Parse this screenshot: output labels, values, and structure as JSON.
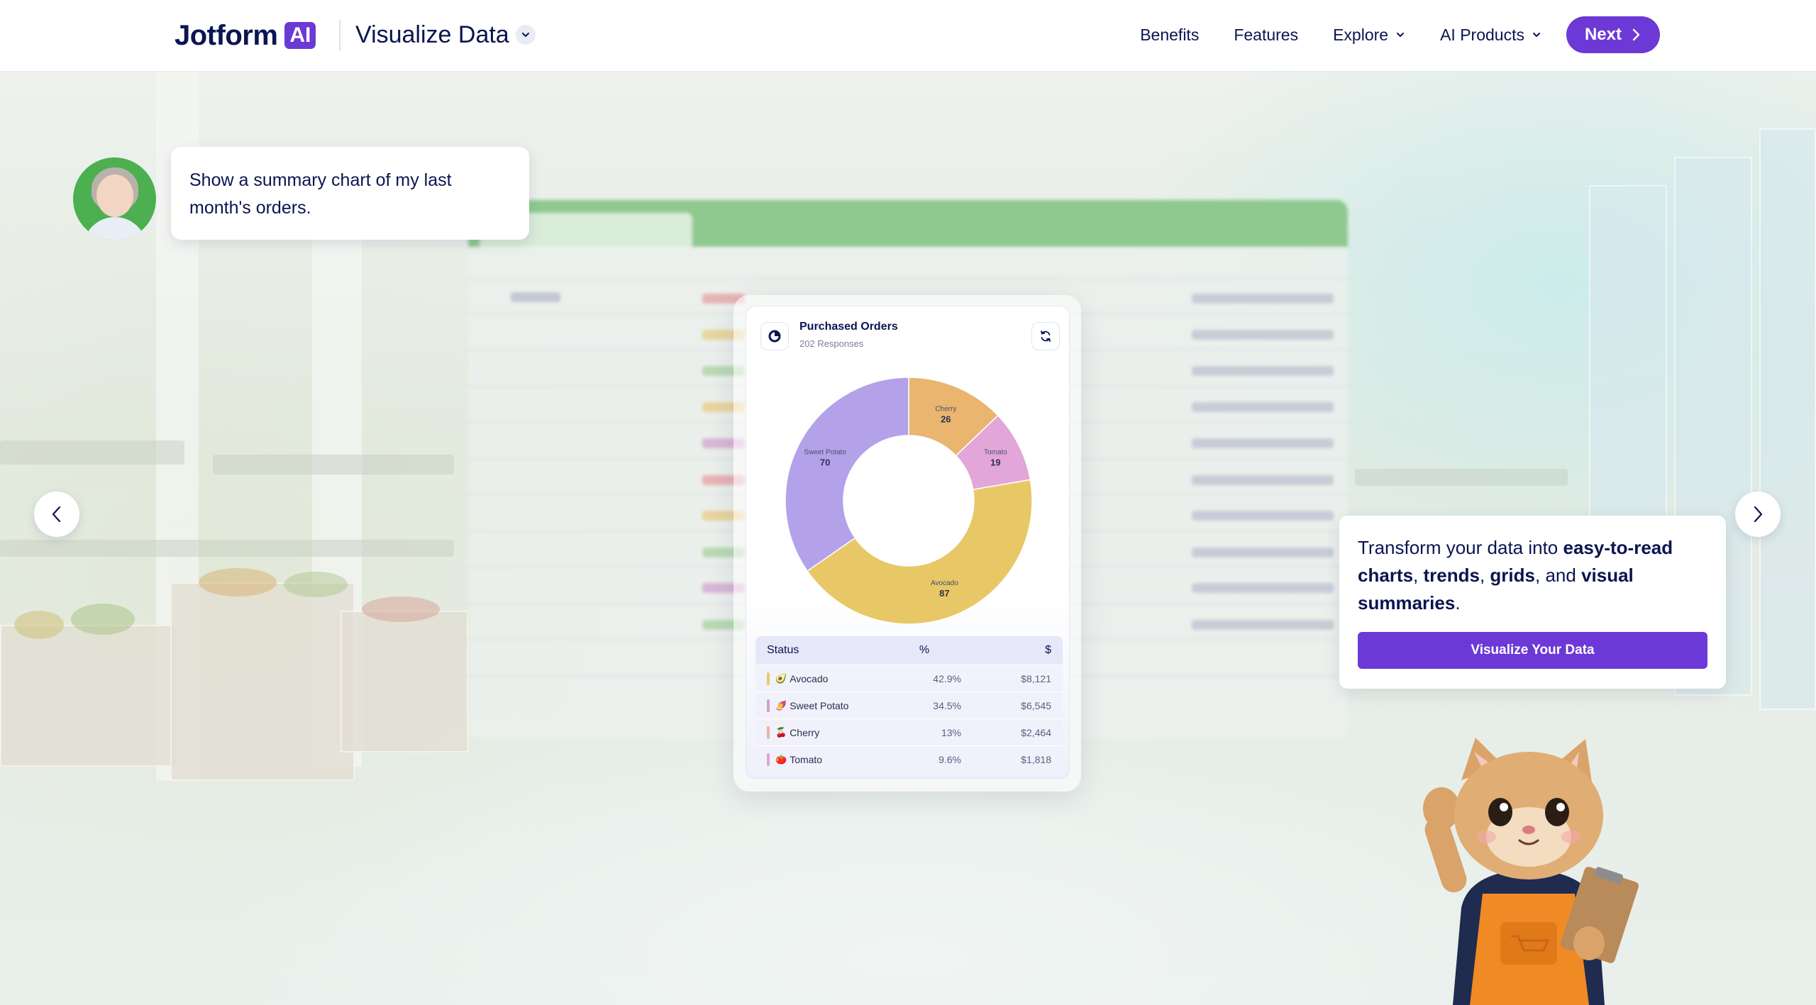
{
  "header": {
    "logo_text": "Jotform",
    "logo_badge": "AI",
    "product_title": "Visualize Data",
    "nav": {
      "benefits": "Benefits",
      "features": "Features",
      "explore": "Explore",
      "ai_products": "AI Products",
      "next": "Next"
    }
  },
  "chat": {
    "user_message": "Show a summary chart of my last month's orders."
  },
  "chart_card": {
    "title": "Purchased Orders",
    "subtitle": "202 Responses",
    "table": {
      "headers": [
        "Status",
        "%",
        "$"
      ],
      "rows": [
        {
          "icon": "🥑",
          "label": "Avocado",
          "percent": "42.9%",
          "amount": "$8,121",
          "color": "#e9c96a"
        },
        {
          "icon": "🍠",
          "label": "Sweet Potato",
          "percent": "34.5%",
          "amount": "$6,545",
          "color": "#b9a6ec"
        },
        {
          "icon": "🍒",
          "label": "Cherry",
          "percent": "13%",
          "amount": "$2,464",
          "color": "#eab57a"
        },
        {
          "icon": "🍅",
          "label": "Tomato",
          "percent": "9.6%",
          "amount": "$1,818",
          "color": "#e4a9d6"
        }
      ]
    }
  },
  "chart_data": {
    "type": "pie",
    "title": "Purchased Orders",
    "subtitle": "202 Responses",
    "categories": [
      "Cherry",
      "Tomato",
      "Avocado",
      "Sweet Potato"
    ],
    "values": [
      26,
      19,
      87,
      70
    ],
    "colors": [
      "#e9b56f",
      "#e3a6d8",
      "#e8c767",
      "#b3a2ea"
    ],
    "donut": true
  },
  "cta": {
    "text_1": "Transform your data into ",
    "bold_1": "easy-to-read charts",
    "text_2": ", ",
    "bold_2": "trends",
    "text_3": ", ",
    "bold_3": "grids",
    "text_4": ", and ",
    "bold_4": "visual summaries",
    "text_5": ".",
    "button": "Visualize Your Data"
  },
  "colors": {
    "brand_purple": "#6c39d6",
    "navy": "#0a1551"
  },
  "icons": [
    "chevron-down-icon",
    "chevron-right-icon",
    "chevron-left-icon",
    "pie-chart-icon",
    "refresh-icon"
  ]
}
